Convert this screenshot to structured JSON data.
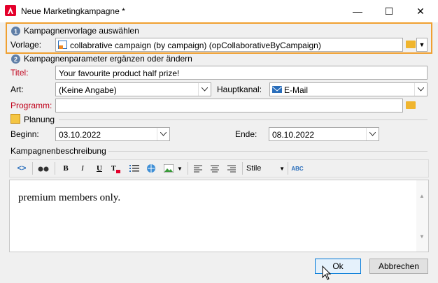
{
  "window": {
    "title": "Neue Marketingkampagne *",
    "minimize": "—",
    "maximize": "☐",
    "close": "✕"
  },
  "section1": {
    "num": "1",
    "heading": "Kampagnenvorlage auswählen",
    "vorlage_label": "Vorlage:",
    "vorlage_value": "collabrative campaign  (by campaign) (opCollaborativeByCampaign)"
  },
  "section2": {
    "num": "2",
    "heading": "Kampagnenparameter ergänzen oder ändern"
  },
  "fields": {
    "titel_label": "Titel:",
    "titel_value": "Your favourite product half prize!",
    "art_label": "Art:",
    "art_value": "(Keine Angabe)",
    "hauptkanal_label": "Hauptkanal:",
    "hauptkanal_value": "E-Mail",
    "programm_label": "Programm:",
    "programm_value": ""
  },
  "planung": {
    "heading": "Planung",
    "beginn_label": "Beginn:",
    "beginn_value": "03.10.2022",
    "ende_label": "Ende:",
    "ende_value": "08.10.2022"
  },
  "description": {
    "heading": "Kampagnenbeschreibung",
    "toolbar": {
      "bold": "B",
      "italic": "I",
      "underline": "U",
      "style_label": "Stile"
    },
    "content": "premium members only."
  },
  "buttons": {
    "ok": "Ok",
    "cancel": "Abbrechen"
  },
  "colors": {
    "highlight_border": "#f0a030",
    "accent": "#0078d7",
    "red_label": "#c0001a"
  }
}
